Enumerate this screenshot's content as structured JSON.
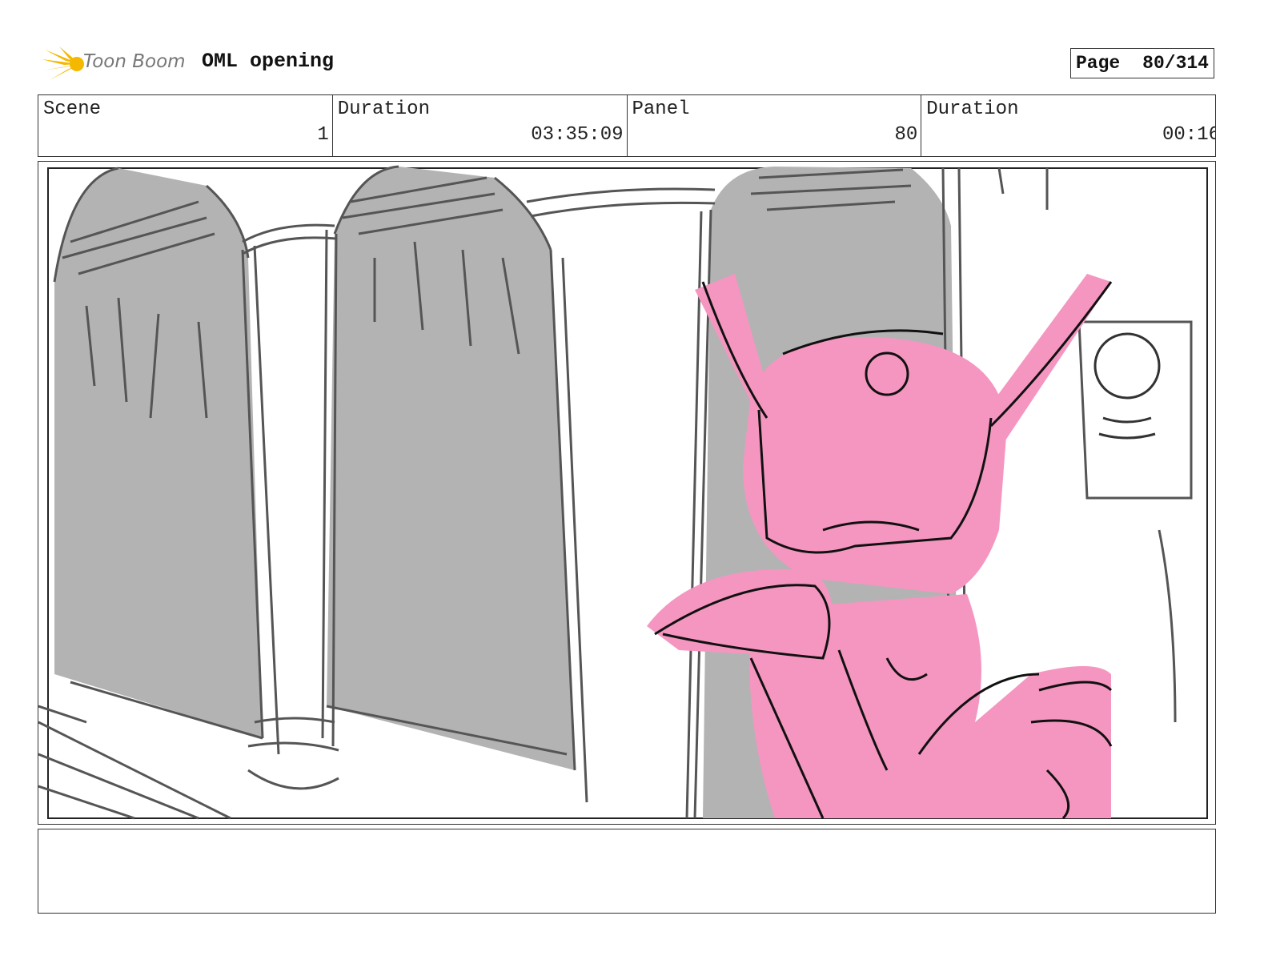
{
  "header": {
    "logo_text": "Toon Boom",
    "project_title": "OML opening",
    "page_label": "Page",
    "page_number": "80/314"
  },
  "info": {
    "scene_label": "Scene",
    "scene_value": "1",
    "duration_label": "Duration",
    "duration_value": "03:35:09",
    "panel_label": "Panel",
    "panel_value": "80",
    "panel_duration_label": "Duration",
    "panel_duration_value": "00:16"
  },
  "colors": {
    "logo_accent": "#f5b800",
    "sketch_gray": "#b3b3b3",
    "character_pink": "#f596c1"
  },
  "icons": {
    "logo": "toon-boom-star-icon"
  }
}
